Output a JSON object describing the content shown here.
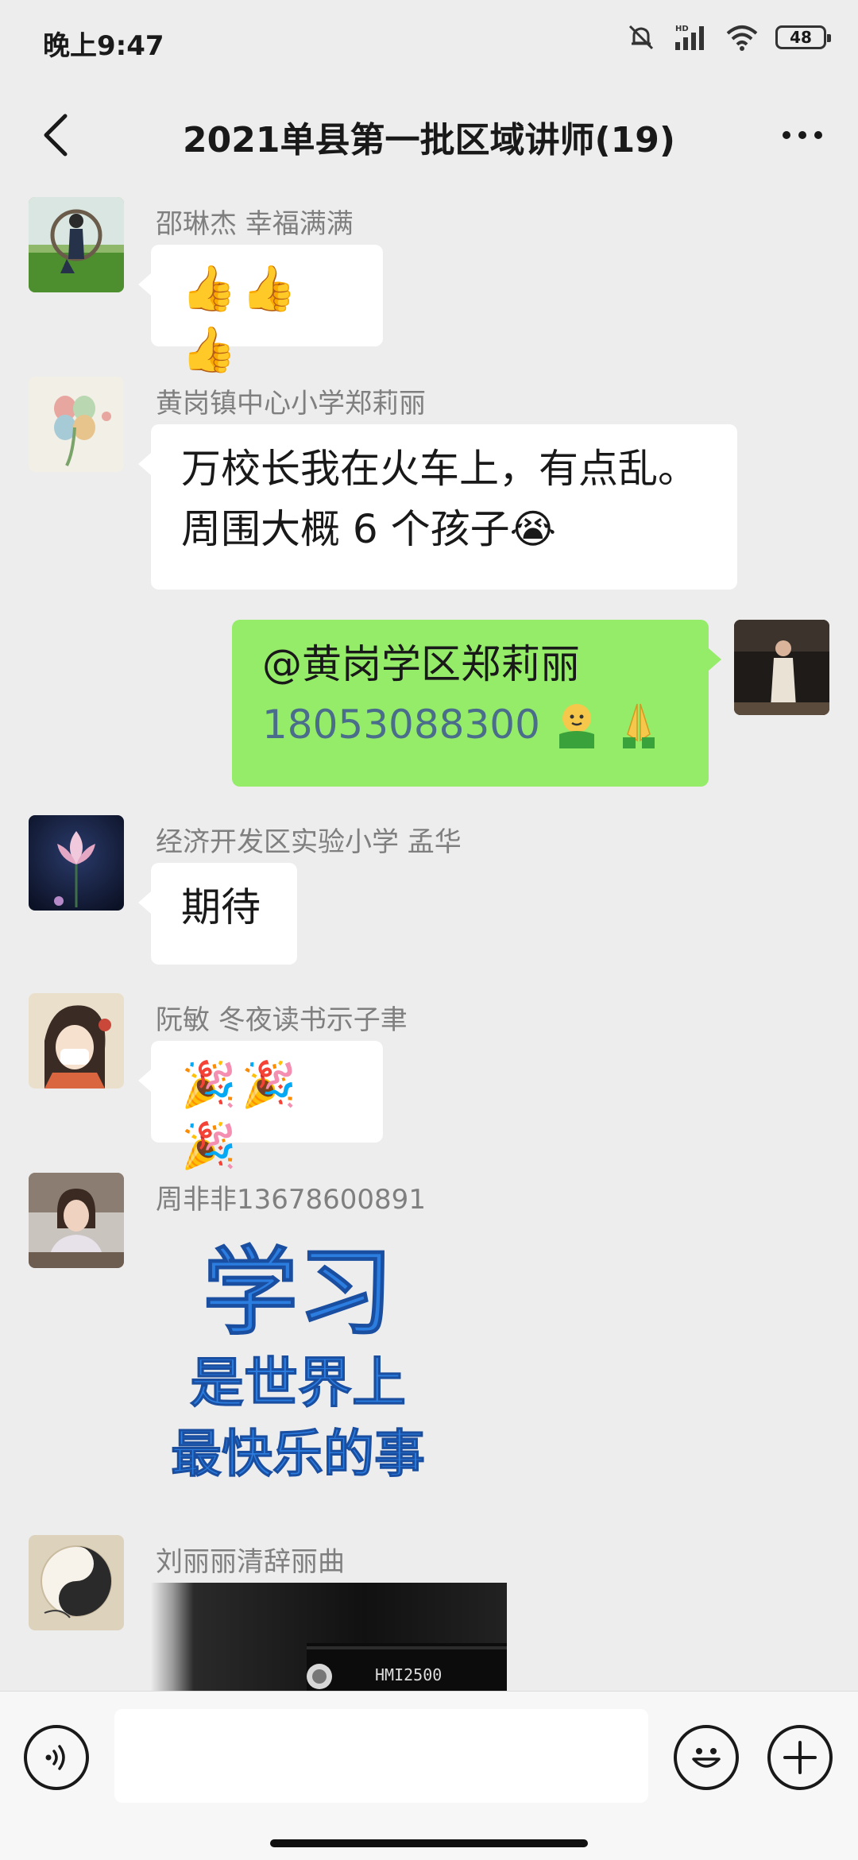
{
  "status_bar": {
    "time": "晚上9:47",
    "battery": "48"
  },
  "header": {
    "title": "2021单县第一批区域讲师(19)"
  },
  "messages": [
    {
      "sender": "邵琳杰  幸福满满",
      "content": "👍👍👍"
    },
    {
      "sender": "黄岗镇中心小学郑莉丽",
      "line1": "万校长我在火车上，有点乱。",
      "line2": "周围大概 6 个孩子😭"
    },
    {
      "mention": "@黄岗学区郑莉丽",
      "phone": "18053088300"
    },
    {
      "sender": "经济开发区实验小学   孟华",
      "content": "期待"
    },
    {
      "sender": "阮敏   冬夜读书示子聿",
      "content": "🎉🎉🎉"
    },
    {
      "sender": "周非非13678600891",
      "sticker_line1": "学习",
      "sticker_line2": "是世界上",
      "sticker_line3": "最快乐的事"
    },
    {
      "sender": "刘丽丽清辞丽曲",
      "video_label": "HMI2500"
    }
  ],
  "input": {
    "value": "",
    "placeholder": ""
  },
  "colors": {
    "bg": "#ededed",
    "self_bubble": "#95ec69",
    "other_bubble": "#ffffff",
    "sticker_blue": "#2b7de0"
  }
}
